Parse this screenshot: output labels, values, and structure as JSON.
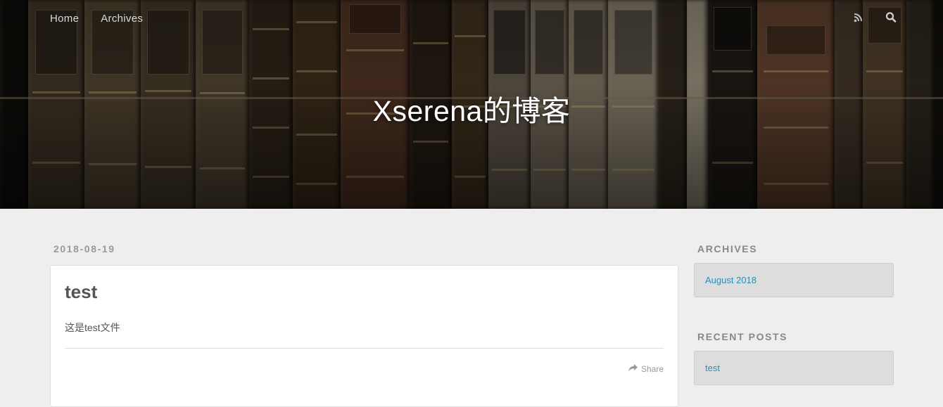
{
  "nav": {
    "links": [
      {
        "label": "Home"
      },
      {
        "label": "Archives"
      }
    ],
    "icons": [
      "rss-icon",
      "search-icon"
    ]
  },
  "site": {
    "title": "Xserena的博客"
  },
  "post": {
    "date": "2018-08-19",
    "title": "test",
    "body": "这是test文件",
    "share_label": "Share"
  },
  "sidebar": {
    "archives": {
      "title": "ARCHIVES",
      "items": [
        {
          "label": "August 2018"
        }
      ]
    },
    "recent_posts": {
      "title": "RECENT POSTS",
      "items": [
        {
          "label": "test"
        }
      ]
    }
  },
  "colors": {
    "background": "#eeeeee",
    "link": "#258fb8",
    "muted": "#999999",
    "card": "#ffffff",
    "widget": "#dddddd"
  }
}
